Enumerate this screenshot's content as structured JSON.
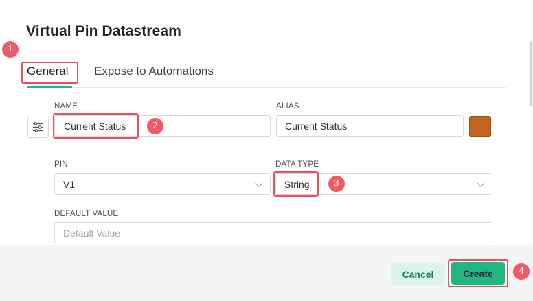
{
  "dialog": {
    "title": "Virtual Pin Datastream"
  },
  "tabs": [
    {
      "label": "General",
      "active": true
    },
    {
      "label": "Expose to Automations",
      "active": false
    }
  ],
  "form": {
    "name": {
      "label": "NAME",
      "value": "Current Status"
    },
    "alias": {
      "label": "ALIAS",
      "value": "Current Status"
    },
    "pin": {
      "label": "PIN",
      "value": "V1"
    },
    "data_type": {
      "label": "DATA TYPE",
      "value": "String"
    },
    "default_value": {
      "label": "DEFAULT VALUE",
      "placeholder": "Default Value"
    },
    "color_swatch": "#c0651f"
  },
  "footer": {
    "cancel_label": "Cancel",
    "create_label": "Create"
  },
  "annotations": [
    "1",
    "2",
    "3",
    "4"
  ],
  "colors": {
    "accent": "#23b884",
    "highlight": "#e94f5f"
  }
}
